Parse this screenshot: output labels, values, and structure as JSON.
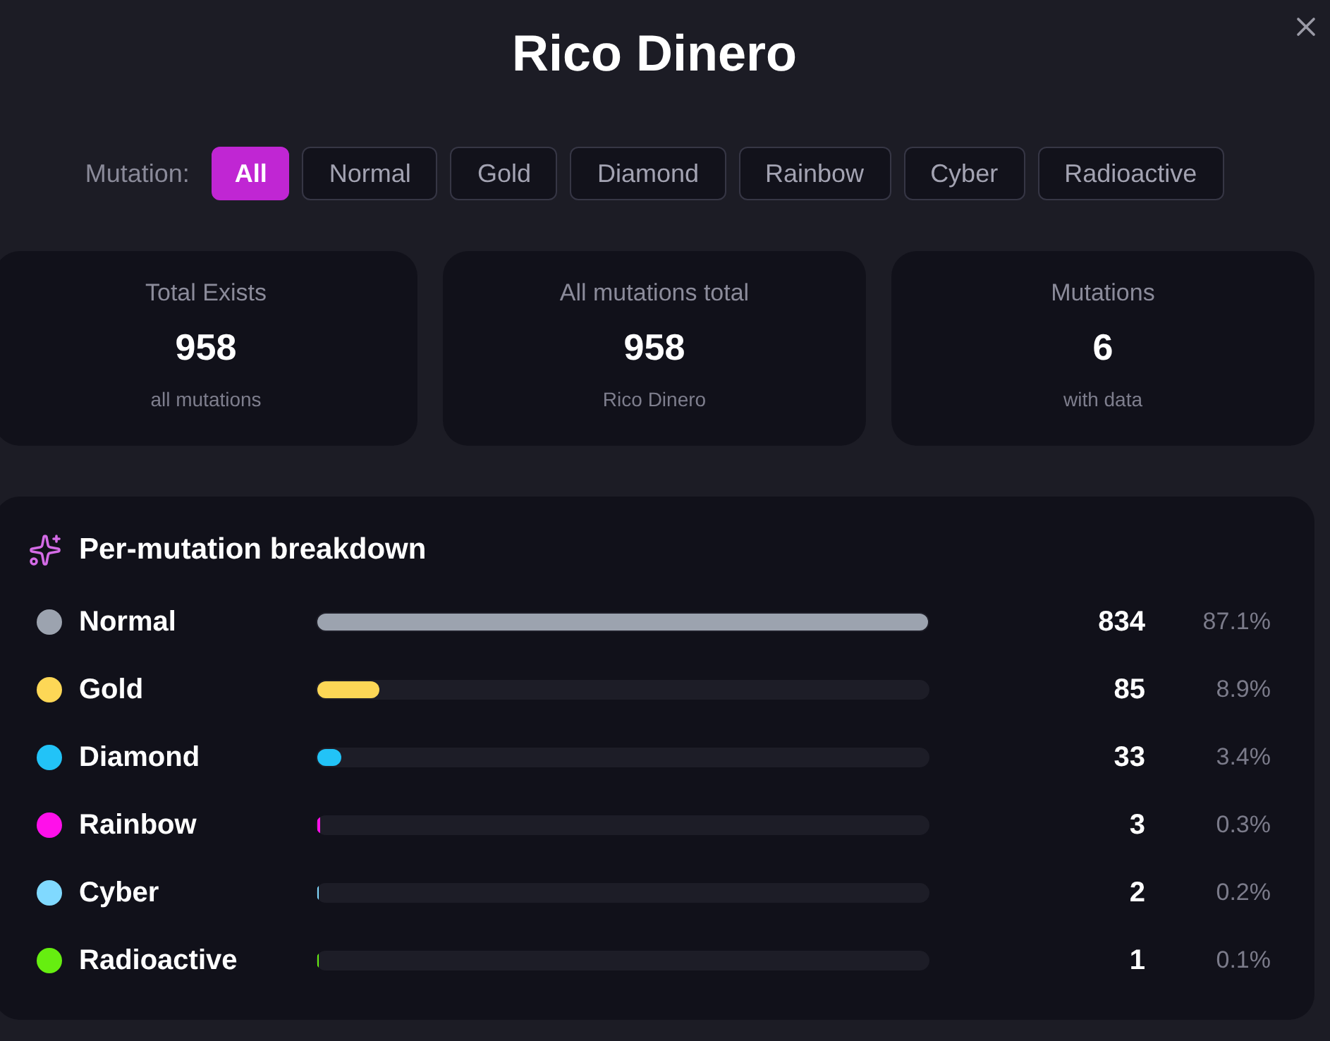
{
  "title": "Rico Dinero",
  "filter": {
    "label": "Mutation:",
    "tabs": [
      {
        "label": "All",
        "selected": true
      },
      {
        "label": "Normal",
        "selected": false
      },
      {
        "label": "Gold",
        "selected": false
      },
      {
        "label": "Diamond",
        "selected": false
      },
      {
        "label": "Rainbow",
        "selected": false
      },
      {
        "label": "Cyber",
        "selected": false
      },
      {
        "label": "Radioactive",
        "selected": false
      }
    ]
  },
  "stats": [
    {
      "label": "Total Exists",
      "value": "958",
      "caption": "all mutations"
    },
    {
      "label": "All mutations total",
      "value": "958",
      "caption": "Rico Dinero"
    },
    {
      "label": "Mutations",
      "value": "6",
      "caption": "with data"
    }
  ],
  "breakdown": {
    "title": "Per-mutation breakdown",
    "rows": [
      {
        "name": "Normal",
        "color": "#9ca3af",
        "level": 1,
        "count": "834",
        "percent": "87.1%"
      },
      {
        "name": "Gold",
        "color": "#fdd756",
        "level": 0.102,
        "count": "85",
        "percent": "8.9%"
      },
      {
        "name": "Diamond",
        "color": "#22c3f7",
        "level": 0.04,
        "count": "33",
        "percent": "3.4%"
      },
      {
        "name": "Rainbow",
        "color": "#ff10ea",
        "level": 0.0036,
        "count": "3",
        "percent": "0.3%"
      },
      {
        "name": "Cyber",
        "color": "#80d9ff",
        "level": 0.0024,
        "count": "2",
        "percent": "0.2%"
      },
      {
        "name": "Radioactive",
        "color": "#66ee10",
        "level": 0.0012,
        "count": "1",
        "percent": "0.1%"
      }
    ]
  }
}
